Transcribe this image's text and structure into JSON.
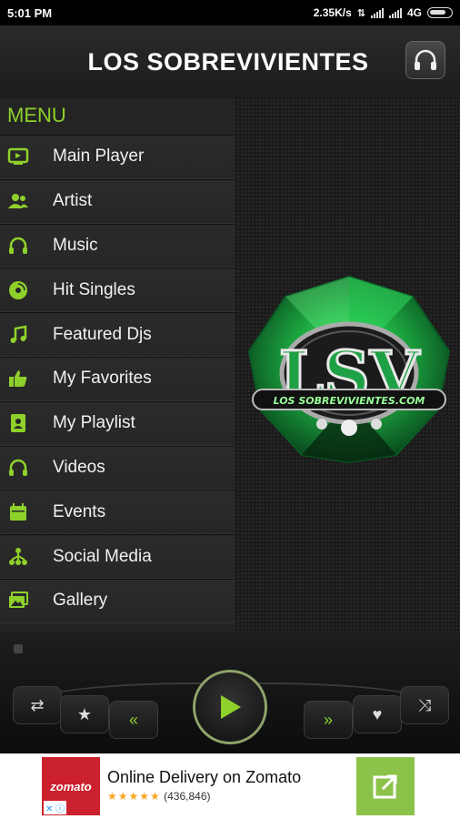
{
  "status_bar": {
    "time": "5:01 PM",
    "net_speed": "2.35K/s",
    "network": "4G"
  },
  "header": {
    "title": "LOS SOBREVIVIENTES"
  },
  "menu": {
    "title": "MENU",
    "items": [
      {
        "label": "Main Player",
        "icon": "tv-icon"
      },
      {
        "label": "Artist",
        "icon": "people-icon"
      },
      {
        "label": "Music",
        "icon": "headphones-icon"
      },
      {
        "label": "Hit Singles",
        "icon": "disc-icon"
      },
      {
        "label": "Featured Djs",
        "icon": "music-note-icon"
      },
      {
        "label": "My Favorites",
        "icon": "thumbs-up-icon"
      },
      {
        "label": "My Playlist",
        "icon": "playlist-icon"
      },
      {
        "label": "Videos",
        "icon": "headphones-icon"
      },
      {
        "label": "Events",
        "icon": "calendar-icon"
      },
      {
        "label": "Social Media",
        "icon": "network-icon"
      },
      {
        "label": "Gallery",
        "icon": "gallery-icon"
      }
    ]
  },
  "logo": {
    "letters": "LSV",
    "text": "LOS SOBREVIVIENTES.COM"
  },
  "ad": {
    "brand": "zomato",
    "title": "Online Delivery on Zomato",
    "stars": "★★★★★",
    "reviews": "(436,846)"
  },
  "colors": {
    "accent": "#8fd12b",
    "menu_bg": "#222222",
    "ad_brand": "#cb202d",
    "ad_cta": "#8bc34a"
  }
}
